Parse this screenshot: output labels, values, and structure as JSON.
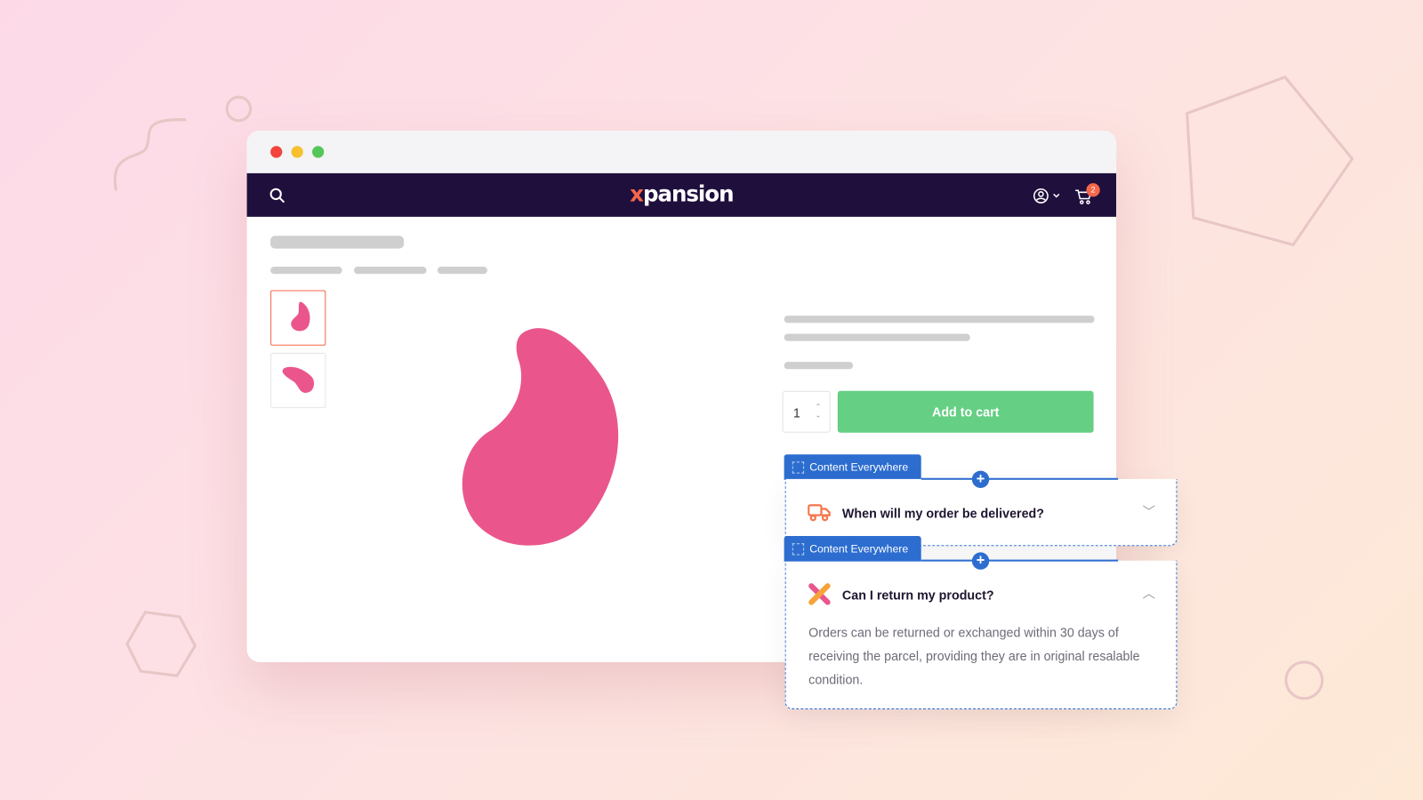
{
  "navbar": {
    "logo_x": "x",
    "logo_text": "pansion",
    "cart_count": "2"
  },
  "product": {
    "quantity": "1",
    "add_to_cart_label": "Add to cart"
  },
  "content_blocks": [
    {
      "tag_label": "Content Everywhere",
      "question": "When will my order be delivered?",
      "icon": "truck-icon",
      "expanded": false
    },
    {
      "tag_label": "Content Everywhere",
      "question": "Can I return my product?",
      "icon": "x-logo-icon",
      "expanded": true,
      "answer": "Orders can be returned or exchanged within 30 days of receiving the parcel, providing they are in original resalable condition."
    }
  ],
  "colors": {
    "nav": "#1f0f3c",
    "accent": "#f5664a",
    "button": "#65cf83",
    "product": "#ea568c",
    "content_everywhere": "#2d6dd0"
  }
}
